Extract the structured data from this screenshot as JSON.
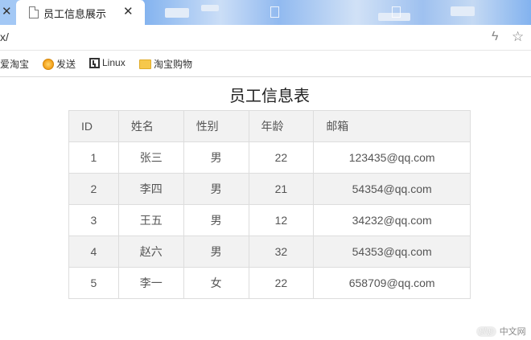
{
  "browser": {
    "active_tab": {
      "title": "员工信息展示",
      "icon": "document-icon"
    },
    "address": {
      "url": "x/"
    },
    "bookmarks": [
      {
        "label": "爱淘宝",
        "icon": "none"
      },
      {
        "label": "发送",
        "icon": "orange-circle-icon"
      },
      {
        "label": "Linux",
        "icon": "linux-icon"
      },
      {
        "label": "淘宝购物",
        "icon": "folder-icon"
      }
    ]
  },
  "page": {
    "title": "员工信息表",
    "table": {
      "headers": [
        "ID",
        "姓名",
        "性别",
        "年龄",
        "邮箱"
      ],
      "rows": [
        [
          "1",
          "张三",
          "男",
          "22",
          "123435@qq.com"
        ],
        [
          "2",
          "李四",
          "男",
          "21",
          "54354@qq.com"
        ],
        [
          "3",
          "王五",
          "男",
          "12",
          "34232@qq.com"
        ],
        [
          "4",
          "赵六",
          "男",
          "32",
          "54353@qq.com"
        ],
        [
          "5",
          "李一",
          "女",
          "22",
          "658709@qq.com"
        ]
      ]
    }
  },
  "watermark": {
    "logo": "php",
    "text": "中文网"
  },
  "colors": {
    "tab_bar": "#a3c8f5",
    "header_row": "#f2f2f2",
    "alt_row": "#f2f2f2",
    "border": "#dddddd"
  }
}
